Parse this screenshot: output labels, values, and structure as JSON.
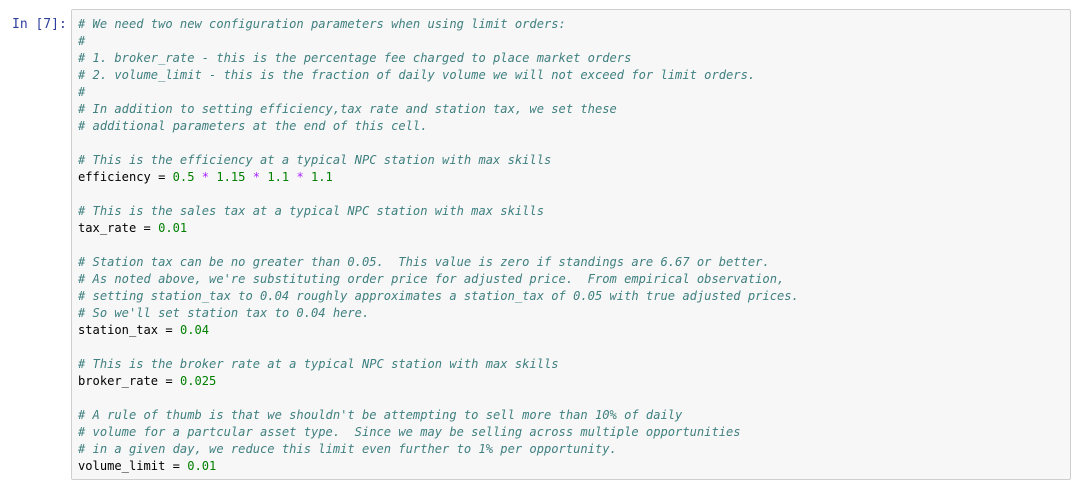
{
  "prompt": "In [7]:",
  "lines": [
    [
      {
        "t": "c",
        "s": "# We need two new configuration parameters when using limit orders:"
      }
    ],
    [
      {
        "t": "c",
        "s": "#"
      }
    ],
    [
      {
        "t": "c",
        "s": "# 1. broker_rate - this is the percentage fee charged to place market orders"
      }
    ],
    [
      {
        "t": "c",
        "s": "# 2. volume_limit - this is the fraction of daily volume we will not exceed for limit orders."
      }
    ],
    [
      {
        "t": "c",
        "s": "#"
      }
    ],
    [
      {
        "t": "c",
        "s": "# In addition to setting efficiency,tax rate and station tax, we set these"
      }
    ],
    [
      {
        "t": "c",
        "s": "# additional parameters at the end of this cell."
      }
    ],
    [],
    [
      {
        "t": "c",
        "s": "# This is the efficiency at a typical NPC station with max skills"
      }
    ],
    [
      {
        "t": "v",
        "s": "efficiency"
      },
      {
        "t": "p",
        "s": " = "
      },
      {
        "t": "n",
        "s": "0.5"
      },
      {
        "t": "p",
        "s": " "
      },
      {
        "t": "o",
        "s": "*"
      },
      {
        "t": "p",
        "s": " "
      },
      {
        "t": "n",
        "s": "1.15"
      },
      {
        "t": "p",
        "s": " "
      },
      {
        "t": "o",
        "s": "*"
      },
      {
        "t": "p",
        "s": " "
      },
      {
        "t": "n",
        "s": "1.1"
      },
      {
        "t": "p",
        "s": " "
      },
      {
        "t": "o",
        "s": "*"
      },
      {
        "t": "p",
        "s": " "
      },
      {
        "t": "n",
        "s": "1.1"
      }
    ],
    [],
    [
      {
        "t": "c",
        "s": "# This is the sales tax at a typical NPC station with max skills"
      }
    ],
    [
      {
        "t": "v",
        "s": "tax_rate"
      },
      {
        "t": "p",
        "s": " = "
      },
      {
        "t": "n",
        "s": "0.01"
      }
    ],
    [],
    [
      {
        "t": "c",
        "s": "# Station tax can be no greater than 0.05.  This value is zero if standings are 6.67 or better."
      }
    ],
    [
      {
        "t": "c",
        "s": "# As noted above, we're substituting order price for adjusted price.  From empirical observation,"
      }
    ],
    [
      {
        "t": "c",
        "s": "# setting station_tax to 0.04 roughly approximates a station_tax of 0.05 with true adjusted prices."
      }
    ],
    [
      {
        "t": "c",
        "s": "# So we'll set station tax to 0.04 here."
      }
    ],
    [
      {
        "t": "v",
        "s": "station_tax"
      },
      {
        "t": "p",
        "s": " = "
      },
      {
        "t": "n",
        "s": "0.04"
      }
    ],
    [],
    [
      {
        "t": "c",
        "s": "# This is the broker rate at a typical NPC station with max skills"
      }
    ],
    [
      {
        "t": "v",
        "s": "broker_rate"
      },
      {
        "t": "p",
        "s": " = "
      },
      {
        "t": "n",
        "s": "0.025"
      }
    ],
    [],
    [
      {
        "t": "c",
        "s": "# A rule of thumb is that we shouldn't be attempting to sell more than 10% of daily"
      }
    ],
    [
      {
        "t": "c",
        "s": "# volume for a partcular asset type.  Since we may be selling across multiple opportunities"
      }
    ],
    [
      {
        "t": "c",
        "s": "# in a given day, we reduce this limit even further to 1% per opportunity."
      }
    ],
    [
      {
        "t": "v",
        "s": "volume_limit"
      },
      {
        "t": "p",
        "s": " = "
      },
      {
        "t": "n",
        "s": "0.01"
      }
    ]
  ]
}
